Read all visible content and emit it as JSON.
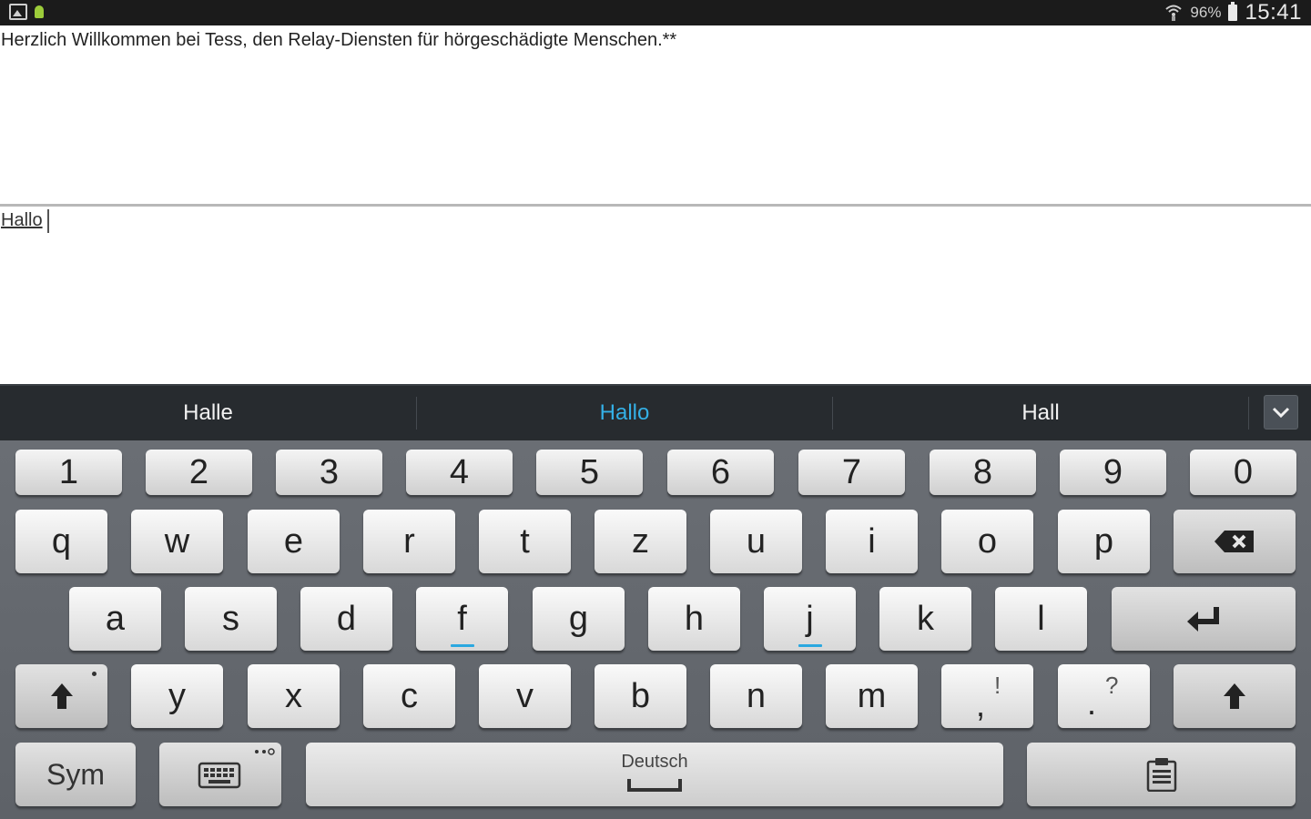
{
  "status_bar": {
    "battery_percent": "96%",
    "time": "15:41",
    "icons": [
      "gallery-icon",
      "android-icon",
      "wifi-icon",
      "battery-icon"
    ]
  },
  "conversation": {
    "message": "Herzlich Willkommen bei Tess, den Relay-Diensten für hörgeschädigte Menschen.**"
  },
  "input": {
    "value": "Hallo"
  },
  "suggestions": {
    "items": [
      "Halle",
      "Hallo",
      "Hall"
    ],
    "active_index": 1,
    "active_color": "#34b0e6"
  },
  "keyboard": {
    "number_row": [
      "1",
      "2",
      "3",
      "4",
      "5",
      "6",
      "7",
      "8",
      "9",
      "0"
    ],
    "row1": [
      "q",
      "w",
      "e",
      "r",
      "t",
      "z",
      "u",
      "i",
      "o",
      "p"
    ],
    "row2": [
      "a",
      "s",
      "d",
      "f",
      "g",
      "h",
      "j",
      "k",
      "l"
    ],
    "row3": [
      "y",
      "x",
      "c",
      "v",
      "b",
      "n",
      "m"
    ],
    "comma_key": {
      "main": ",",
      "alt": "!"
    },
    "period_key": {
      "main": ".",
      "alt": "?"
    },
    "sym_label": "Sym",
    "space_label": "Deutsch",
    "icons": [
      "backspace-icon",
      "enter-icon",
      "shift-icon",
      "keyboard-icon",
      "clipboard-icon",
      "chevron-down-icon"
    ]
  }
}
